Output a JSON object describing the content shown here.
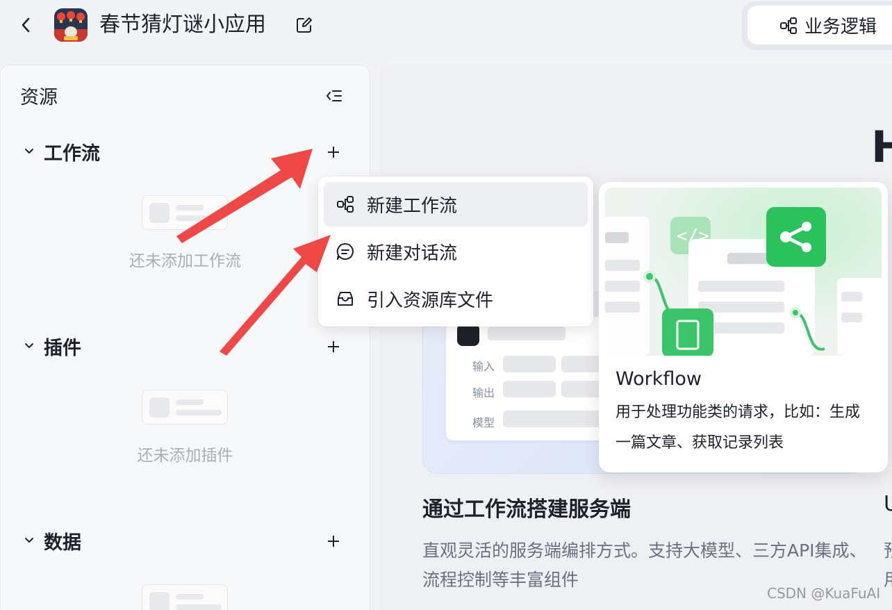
{
  "header": {
    "app_title": "春节猜灯谜小应用",
    "business_logic_label": "业务逻辑",
    "icons": {
      "back": "chevron-left-icon",
      "edit": "edit-icon",
      "business": "flow-icon"
    }
  },
  "sidebar": {
    "title": "资源",
    "sections": [
      {
        "label": "工作流",
        "empty_text": "还未添加工作流"
      },
      {
        "label": "插件",
        "empty_text": "还未添加插件"
      },
      {
        "label": "数据",
        "empty_text": ""
      }
    ]
  },
  "dropdown": {
    "items": [
      {
        "label": "新建工作流",
        "icon": "workflow-icon"
      },
      {
        "label": "新建对话流",
        "icon": "chat-icon"
      },
      {
        "label": "引入资源库文件",
        "icon": "inbox-icon"
      }
    ]
  },
  "tooltip": {
    "title": "Workflow",
    "description": "用于处理功能类的请求，比如：生成一篇文章、获取记录列表"
  },
  "main": {
    "hero_letter": "H",
    "card_title": "通过工作流搭建服务端",
    "card_description": "直观灵活的服务端编排方式。支持大模型、三方API集成、流程控制等丰富组件",
    "form_labels": {
      "input": "输入",
      "output": "输出",
      "model": "模型"
    },
    "edge_title_letter": "U",
    "edge_desc_text": "预\n用"
  },
  "watermark": "CSDN @KuaFuAI",
  "colors": {
    "accent_green": "#2bc15c",
    "arrow_red": "#f04846"
  }
}
